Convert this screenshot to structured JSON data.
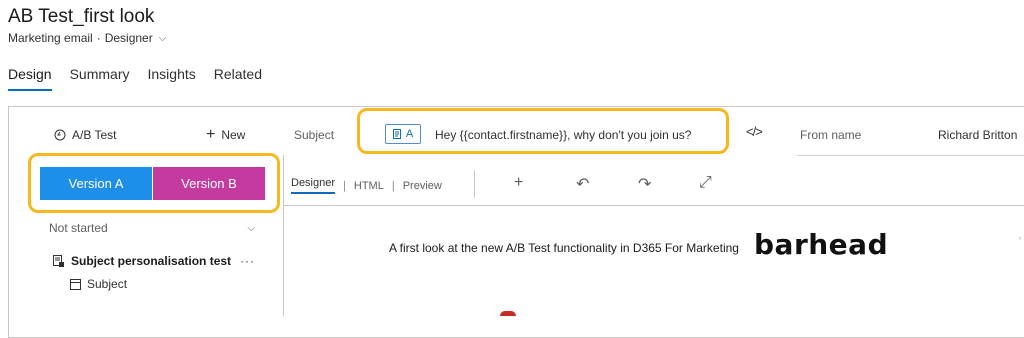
{
  "page": {
    "title": "AB Test_first look",
    "entity": "Marketing email",
    "separator": "·",
    "form": "Designer",
    "form_chevron": "⌵"
  },
  "tabs": [
    {
      "label": "Design",
      "active": true
    },
    {
      "label": "Summary",
      "active": false
    },
    {
      "label": "Insights",
      "active": false
    },
    {
      "label": "Related",
      "active": false
    }
  ],
  "toolbar": {
    "ab_test_label": "A/B Test",
    "ab_test_icon": "history-icon",
    "new_label": "New",
    "new_icon": "plus-icon",
    "subject_label": "Subject",
    "subject_chip": "A",
    "subject_value": "Hey {{contact.firstname}}, why don't you join us?",
    "code_icon": "</>",
    "from_label": "From name",
    "from_value": "Richard Britton"
  },
  "versions": {
    "a_label": "Version A",
    "b_label": "Version B",
    "a_color": "#1e8fe8",
    "b_color": "#c33b9e"
  },
  "test_panel": {
    "status": "Not started",
    "test_name": "Subject personalisation test",
    "more": "···",
    "element": "Subject"
  },
  "editor": {
    "tabs": [
      {
        "label": "Designer",
        "active": true
      },
      {
        "label": "HTML",
        "active": false
      },
      {
        "label": "Preview",
        "active": false
      }
    ],
    "separator": "|",
    "tools": {
      "add": "+",
      "undo": "↶",
      "redo": "↷",
      "expand": "⤢"
    }
  },
  "preview": {
    "heading": "A first look at the new A/B Test functionality in D365 For Marketing",
    "logo_text": "barhead"
  },
  "colors": {
    "highlight": "#f6b81d",
    "accent": "#0f6cbd"
  }
}
